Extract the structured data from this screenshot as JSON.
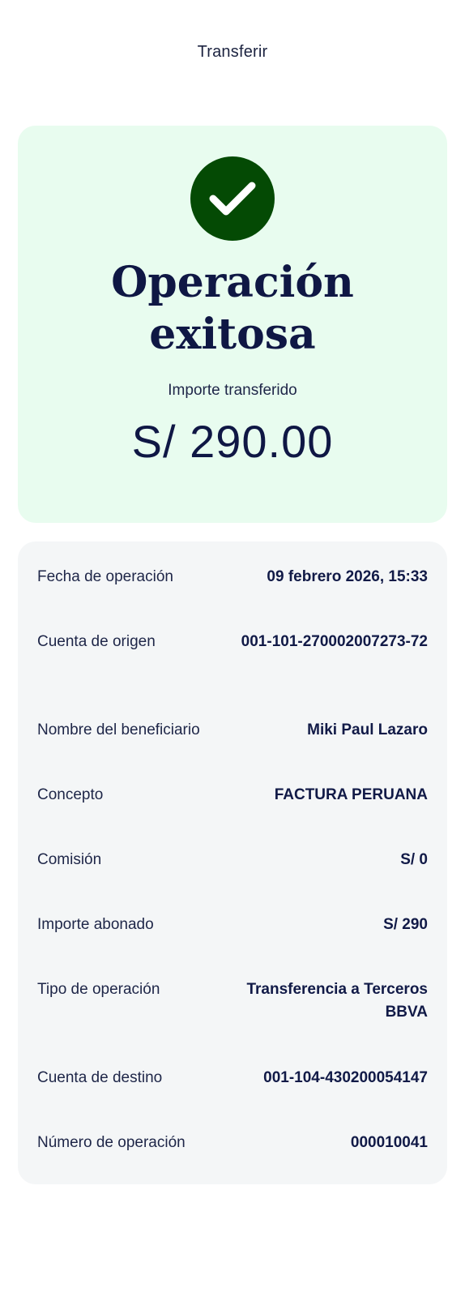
{
  "header": {
    "title": "Transferir"
  },
  "success": {
    "icon": "check-icon",
    "title_line1": "Operación",
    "title_line2": "exitosa",
    "amount_label": "Importe transferido",
    "amount_value": "S/ 290.00",
    "check_color": "#044a04",
    "card_color": "#e8fcef"
  },
  "details": [
    {
      "label": "Fecha de operación",
      "value": "09 febrero 2026, 15:33"
    },
    {
      "label": "Cuenta de origen",
      "value": "001-101-270002007273-72"
    },
    {
      "label": "Nombre del beneficiario",
      "value": "Miki Paul Lazaro"
    },
    {
      "label": "Concepto",
      "value": "FACTURA PERUANA"
    },
    {
      "label": "Comisión",
      "value": "S/ 0"
    },
    {
      "label": "Importe abonado",
      "value": "S/ 290"
    },
    {
      "label": "Tipo de operación",
      "value": "Transferencia a Terceros BBVA"
    },
    {
      "label": "Cuenta de destino",
      "value": "001-104-430200054147"
    },
    {
      "label": "Número de operación",
      "value": "000010041"
    }
  ]
}
